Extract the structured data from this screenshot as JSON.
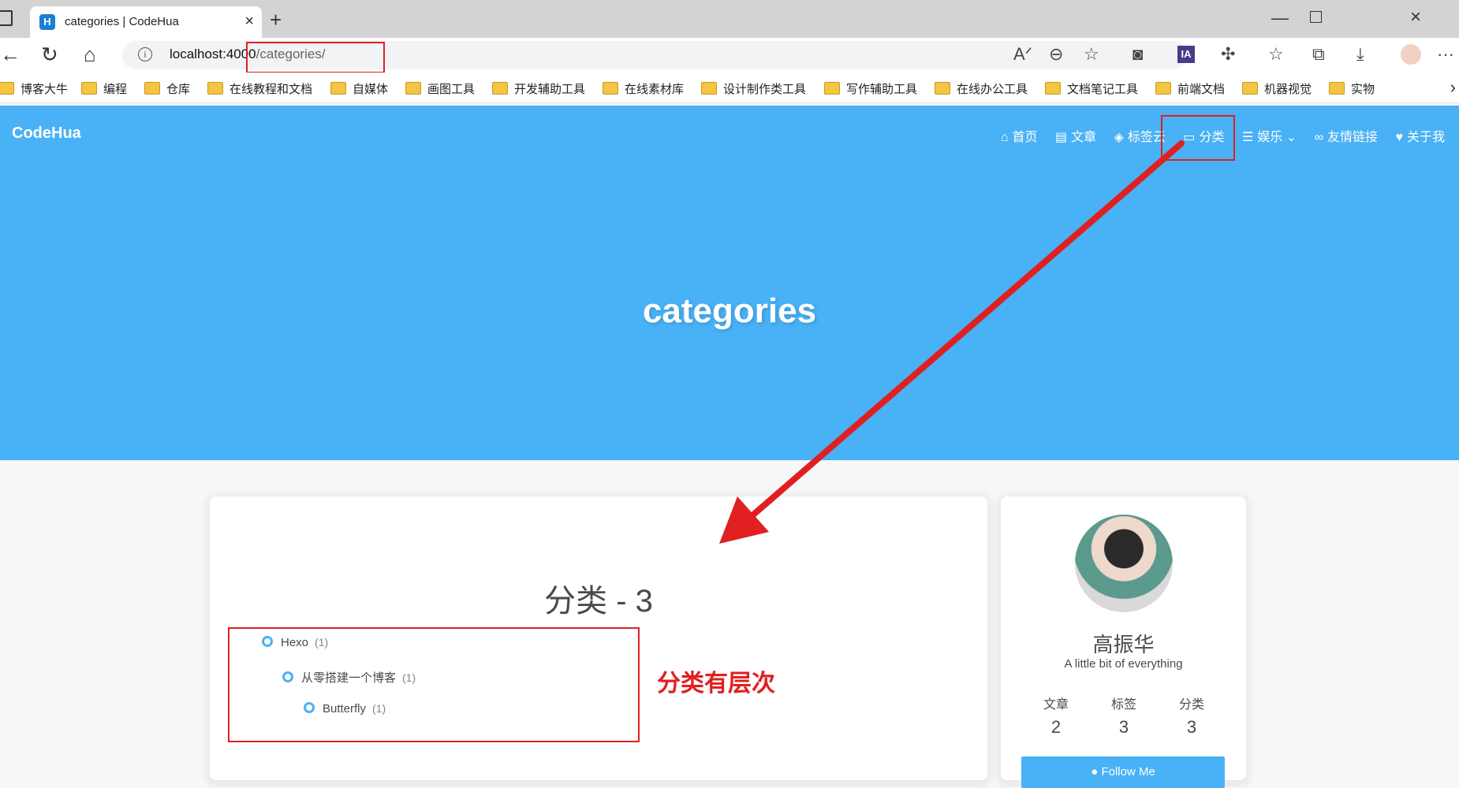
{
  "browser": {
    "tab_title": "categories | CodeHua",
    "favicon_letter": "H",
    "address_host": "localhost:4000",
    "address_path": "/categories/",
    "ia_badge": "IA"
  },
  "bookmarks": [
    "博客大牛",
    "编程",
    "仓库",
    "在线教程和文档",
    "自媒体",
    "画图工具",
    "开发辅助工具",
    "在线素材库",
    "设计制作类工具",
    "写作辅助工具",
    "在线办公工具",
    "文档笔记工具",
    "前端文档",
    "机器视觉",
    "实物"
  ],
  "site": {
    "brand": "CodeHua",
    "menu": [
      {
        "icon": "house-icon",
        "glyph": "⌂",
        "label": "首页"
      },
      {
        "icon": "archive-icon",
        "glyph": "▤",
        "label": "文章"
      },
      {
        "icon": "tags-icon",
        "glyph": "◈",
        "label": "标签云"
      },
      {
        "icon": "folder-open-icon",
        "glyph": "▭",
        "label": "分类"
      },
      {
        "icon": "list-icon",
        "glyph": "☰",
        "label": "娱乐 ⌄"
      },
      {
        "icon": "link-icon",
        "glyph": "∞",
        "label": "友情链接"
      },
      {
        "icon": "heart-icon",
        "glyph": "♥",
        "label": "关于我"
      }
    ],
    "hero_title": "categories"
  },
  "categories": {
    "heading": "分类 - 3",
    "items": [
      {
        "name": "Hexo",
        "count": "(1)"
      },
      {
        "name": "从零搭建一个博客",
        "count": "(1)"
      },
      {
        "name": "Butterfly",
        "count": "(1)"
      }
    ],
    "annotation": "分类有层次"
  },
  "profile": {
    "name": "高振华",
    "description": "A little bit of everything",
    "stats": [
      {
        "label": "文章",
        "value": "2"
      },
      {
        "label": "标签",
        "value": "3"
      },
      {
        "label": "分类",
        "value": "3"
      }
    ],
    "follow_label": "Follow Me"
  },
  "colors": {
    "accent": "#49b1f5",
    "annotation_red": "#e02020"
  }
}
